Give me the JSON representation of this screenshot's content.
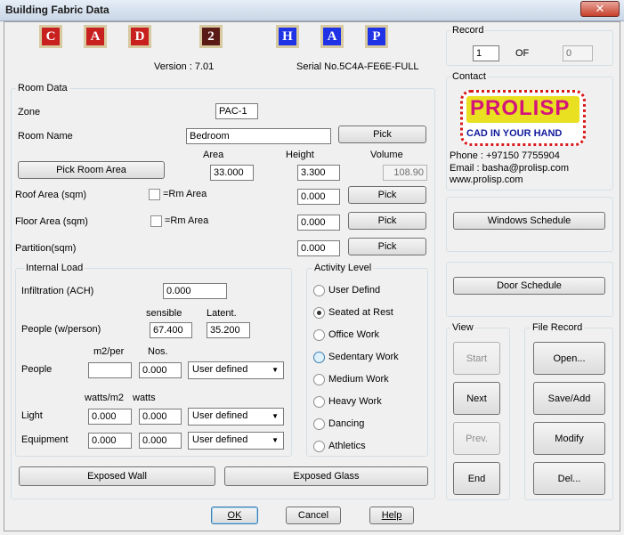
{
  "window": {
    "title": "Building Fabric Data",
    "close_glyph": "✕"
  },
  "logo_letters": [
    {
      "char": "C",
      "bg": "#c8201e"
    },
    {
      "char": "A",
      "bg": "#c8201e"
    },
    {
      "char": "D",
      "bg": "#c8201e"
    },
    {
      "char": "2",
      "bg": "#5a1a16"
    },
    {
      "char": "H",
      "bg": "#1f32e6"
    },
    {
      "char": "A",
      "bg": "#1f32e6"
    },
    {
      "char": "P",
      "bg": "#1f32e6"
    }
  ],
  "version": "Version : 7.01",
  "serial": "Serial No.5C4A-FE6E-FULL",
  "record": {
    "title": "Record",
    "current": "1",
    "of_label": "OF",
    "total": "0"
  },
  "contact": {
    "title": "Contact",
    "logo": {
      "text": "PROLISP",
      "tagline": "CAD IN YOUR HAND"
    },
    "phone": "Phone : +97150 7755904",
    "email": "Email : basha@prolisp.com",
    "web": "www.prolisp.com"
  },
  "buttons_right": {
    "windows_schedule": "Windows Schedule",
    "door_schedule": "Door Schedule"
  },
  "room_data": {
    "title": "Room Data",
    "zone_label": "Zone",
    "zone_value": "PAC-1",
    "room_name_label": "Room Name",
    "room_name_value": "Bedroom",
    "pick_label": "Pick",
    "pick_room_area_label": "Pick Room Area",
    "area_label": "Area",
    "area_value": "33.000",
    "height_label": "Height",
    "height_value": "3.300",
    "volume_label": "Volume",
    "volume_value": "108.90",
    "roof_area_label": "Roof Area (sqm)",
    "roof_rm_area": "=Rm Area",
    "roof_value": "0.000",
    "floor_area_label": "Floor Area (sqm)",
    "floor_rm_area": "=Rm Area",
    "floor_value": "0.000",
    "partition_label": "Partition(sqm)",
    "partition_value": "0.000"
  },
  "internal_load": {
    "title": "Internal Load",
    "infiltration_label": "Infiltration (ACH)",
    "infiltration_value": "0.000",
    "sensible_label": "sensible",
    "latent_label": "Latent.",
    "people_wperson_label": "People (w/person)",
    "sensible_value": "67.400",
    "latent_value": "35.200",
    "m2per_label": "m2/per",
    "nos_label": "Nos.",
    "people_label": "People",
    "people_m2per_value": "",
    "people_nos_value": "0.000",
    "people_combo": "User defined",
    "wattsm2_label": "watts/m2",
    "watts_label": "watts",
    "light_label": "Light",
    "light_wattsm2_value": "0.000",
    "light_watts_value": "0.000",
    "light_combo": "User defined",
    "equipment_label": "Equipment",
    "equipment_wattsm2_value": "0.000",
    "equipment_watts_value": "0.000",
    "equipment_combo": "User defined"
  },
  "activity": {
    "title": "Activity Level",
    "options": [
      "User Defind",
      "Seated at Rest",
      "Office Work",
      "Sedentary Work",
      "Medium Work",
      "Heavy Work",
      "Dancing",
      "Athletics"
    ],
    "selected": "Seated at Rest"
  },
  "view": {
    "title": "View",
    "start": "Start",
    "next": "Next",
    "prev": "Prev.",
    "end": "End"
  },
  "file_record": {
    "title": "File Record",
    "open": "Open...",
    "save_add": "Save/Add",
    "modify": "Modify",
    "del": "Del..."
  },
  "bottom": {
    "exposed_wall": "Exposed Wall",
    "exposed_glass": "Exposed Glass",
    "ok": "OK",
    "cancel": "Cancel",
    "help": "Help"
  }
}
